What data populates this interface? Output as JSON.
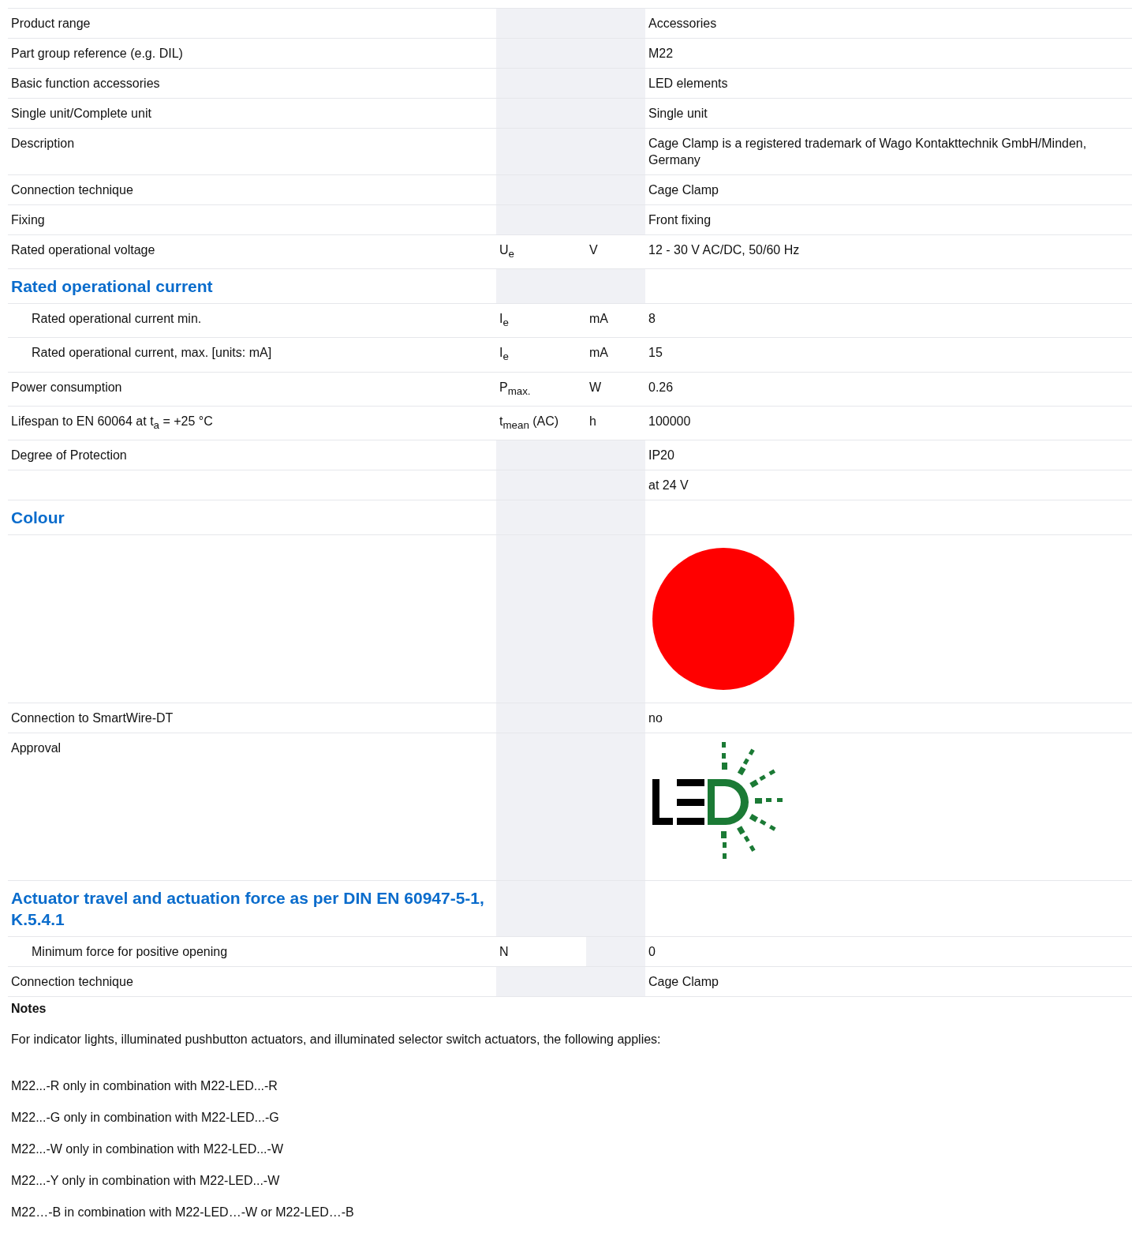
{
  "rows": [
    {
      "kind": "row",
      "label": "Product range",
      "value": "Accessories"
    },
    {
      "kind": "row",
      "label": "Part group reference (e.g. DIL)",
      "value": "M22"
    },
    {
      "kind": "row",
      "label": "Basic function accessories",
      "value": "LED elements"
    },
    {
      "kind": "row",
      "label": "Single unit/Complete unit",
      "value": "Single unit"
    },
    {
      "kind": "row",
      "label": "Description",
      "value": "Cage Clamp is a registered trademark of Wago Kontakttechnik GmbH/Minden, Germany"
    },
    {
      "kind": "row",
      "label": "Connection technique",
      "value": "Cage Clamp"
    },
    {
      "kind": "row",
      "label": "Fixing",
      "value": "Front fixing"
    },
    {
      "kind": "row",
      "label": "Rated operational voltage",
      "symbol": "U$_{e}$",
      "unit": "V",
      "value": "12 - 30 V AC/DC, 50/60 Hz"
    },
    {
      "kind": "heading",
      "label": "Rated operational current",
      "children": [
        {
          "kind": "row",
          "label": "Rated operational current min.",
          "symbol": "I$_{e}$",
          "unit": "mA",
          "value": "8"
        },
        {
          "kind": "row",
          "label": "Rated operational current, max. [units: mA]",
          "symbol": "I$_{e}$",
          "unit": "mA",
          "value": "15"
        }
      ]
    },
    {
      "kind": "row",
      "label": "Power consumption",
      "symbol": "P$_{max.}$",
      "unit": "W",
      "value": "0.26"
    },
    {
      "kind": "row",
      "label": "Lifespan to EN 60064 at t$_{a}$ = +25 °C",
      "symbol": "t$_{mean}$ (AC)",
      "unit": "h",
      "value": "100000"
    },
    {
      "kind": "row",
      "label": "Degree of Protection",
      "value": "IP20"
    },
    {
      "kind": "row",
      "value": "at 24 V"
    },
    {
      "kind": "heading",
      "label": "Colour",
      "children": []
    },
    {
      "kind": "swatch",
      "color": "#ff0000"
    },
    {
      "kind": "row",
      "label": "Connection to SmartWire-DT",
      "value": "no"
    },
    {
      "kind": "logo",
      "label": "Approval"
    },
    {
      "kind": "heading",
      "label": "Actuator travel and actuation force as per DIN EN 60947-5-1, K.5.4.1",
      "children": [
        {
          "kind": "row",
          "label": "Minimum force for positive opening",
          "symbol": "N",
          "value": "0"
        }
      ]
    },
    {
      "kind": "row",
      "label": "Connection technique",
      "value": "Cage Clamp"
    }
  ],
  "notes": {
    "title": "Notes",
    "intro": "For indicator lights, illuminated pushbutton actuators, and illuminated selector switch actuators, the following applies:",
    "lines": [
      "M22...-R only in combination with M22-LED...-R",
      "M22...-G only in combination with M22-LED...-G",
      "M22...-W only in combination with M22-LED...-W",
      "M22...-Y only in combination with M22-LED...-W",
      "M22…-B in combination with M22-LED…-W or M22-LED…-B"
    ]
  }
}
